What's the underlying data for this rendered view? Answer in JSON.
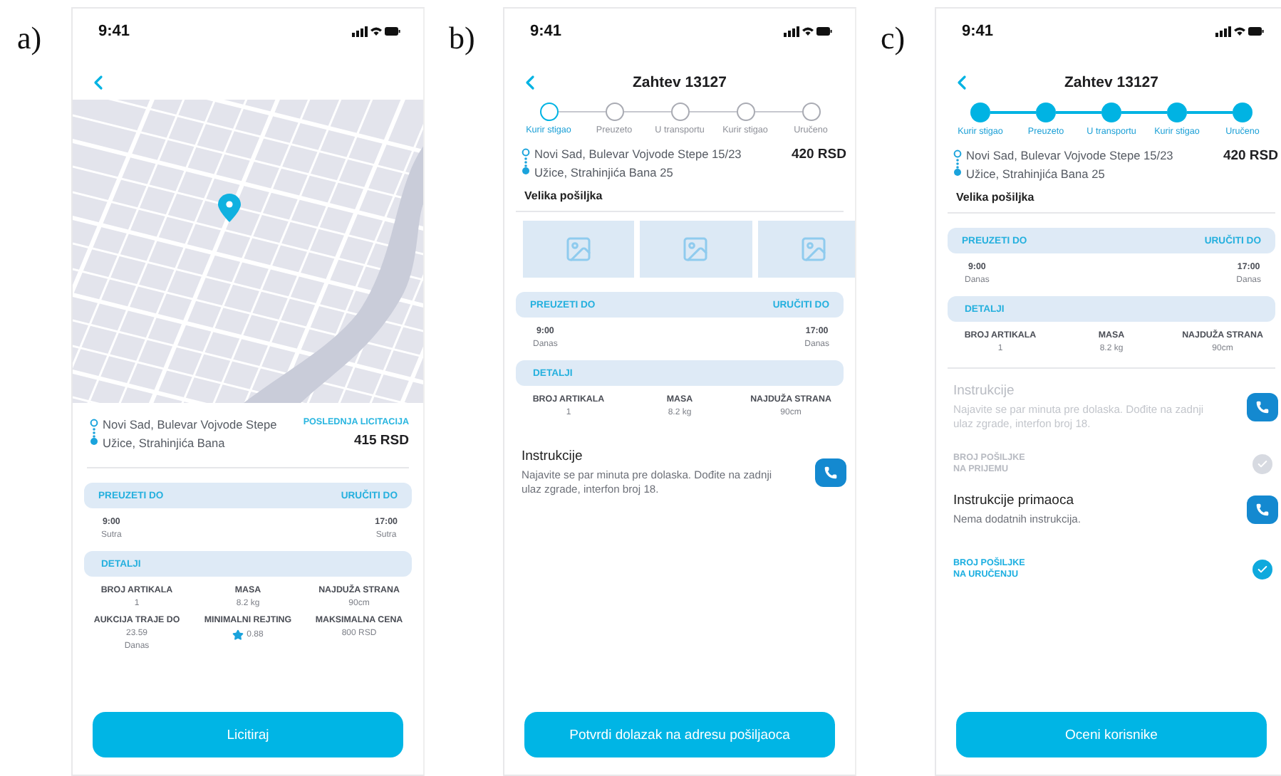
{
  "panels": [
    {
      "label": "a)",
      "status_time": "9:41",
      "sections": [
        {
          "kind": "header"
        },
        {
          "kind": "map"
        },
        {
          "kind": "route",
          "from": "Novi Sad, Bulevar Vojvode Stepe",
          "to": "Užice, Strahinjića Bana",
          "price_label": "POSLEDNJA LICITACIJA",
          "price": "415 RSD"
        },
        {
          "kind": "schedule",
          "pickup_label": "PREUZETI DO",
          "deliver_label": "URUČITI DO",
          "pickup_time": "9:00",
          "pickup_day": "Sutra",
          "deliver_time": "17:00",
          "deliver_day": "Sutra"
        },
        {
          "kind": "details",
          "title": "DETALJI",
          "items": [
            {
              "kind": "text",
              "label": "BROJ ARTIKALA",
              "value": "1"
            },
            {
              "kind": "text",
              "label": "MASA",
              "value": "8.2 kg"
            },
            {
              "kind": "text",
              "label": "NAJDUŽA STRANA",
              "value": "90cm"
            },
            {
              "kind": "text",
              "label": "AUKCIJA TRAJE DO",
              "value": "23.59",
              "sub": "Danas"
            },
            {
              "kind": "rating",
              "label": "MINIMALNI REJTING",
              "value": "0.88"
            },
            {
              "kind": "text",
              "label": "MAKSIMALNA CENA",
              "value": "800 RSD"
            }
          ]
        }
      ],
      "button": "Licitiraj"
    },
    {
      "label": "b)",
      "status_time": "9:41",
      "sections": [
        {
          "kind": "header",
          "title": "Zahtev 13127"
        },
        {
          "kind": "stepper",
          "steps": [
            {
              "label": "Kurir stigao",
              "done": false,
              "selected": true
            },
            {
              "label": "Preuzeto",
              "done": false,
              "selected": false
            },
            {
              "label": "U transportu",
              "done": false,
              "selected": false
            },
            {
              "label": "Kurir stigao",
              "done": false,
              "selected": false
            },
            {
              "label": "Uručeno",
              "done": false,
              "selected": false
            }
          ]
        },
        {
          "kind": "route",
          "from": "Novi Sad, Bulevar Vojvode Stepe 15/23",
          "to": "Užice, Strahinjića Bana 25",
          "price": "420 RSD"
        },
        {
          "kind": "package",
          "text": "Velika pošiljka"
        },
        {
          "kind": "photos",
          "items": [
            {
              "kind": "image"
            },
            {
              "kind": "image"
            },
            {
              "kind": "image"
            }
          ]
        },
        {
          "kind": "schedule",
          "pickup_label": "PREUZETI DO",
          "deliver_label": "URUČITI DO",
          "pickup_time": "9:00",
          "pickup_day": "Danas",
          "deliver_time": "17:00",
          "deliver_day": "Danas"
        },
        {
          "kind": "details",
          "title": "DETALJI",
          "items": [
            {
              "kind": "text",
              "label": "BROJ ARTIKALA",
              "value": "1"
            },
            {
              "kind": "text",
              "label": "MASA",
              "value": "8.2 kg"
            },
            {
              "kind": "text",
              "label": "NAJDUŽA STRANA",
              "value": "90cm"
            }
          ]
        },
        {
          "kind": "instruction",
          "title": "Instrukcije",
          "text": "Najavite se par minuta pre dolaska. Dođite na zadnji ulaz zgrade, interfon broj 18.",
          "disabled": false
        }
      ],
      "button": "Potvrdi dolazak na adresu pošiljaoca"
    },
    {
      "label": "c)",
      "status_time": "9:41",
      "sections": [
        {
          "kind": "header",
          "title": "Zahtev 13127"
        },
        {
          "kind": "stepper",
          "steps": [
            {
              "label": "Kurir stigao",
              "done": true,
              "selected": false
            },
            {
              "label": "Preuzeto",
              "done": true,
              "selected": false
            },
            {
              "label": "U transportu",
              "done": true,
              "selected": false
            },
            {
              "label": "Kurir stigao",
              "done": true,
              "selected": false
            },
            {
              "label": "Uručeno",
              "done": true,
              "selected": false
            }
          ]
        },
        {
          "kind": "route",
          "from": "Novi Sad, Bulevar Vojvode Stepe 15/23",
          "to": "Užice, Strahinjića Bana 25",
          "price": "420 RSD"
        },
        {
          "kind": "package",
          "text": "Velika pošiljka"
        },
        {
          "kind": "schedule",
          "pickup_label": "PREUZETI DO",
          "deliver_label": "URUČITI DO",
          "pickup_time": "9:00",
          "pickup_day": "Danas",
          "deliver_time": "17:00",
          "deliver_day": "Danas"
        },
        {
          "kind": "details",
          "title": "DETALJI",
          "items": [
            {
              "kind": "text",
              "label": "BROJ ARTIKALA",
              "value": "1"
            },
            {
              "kind": "text",
              "label": "MASA",
              "value": "8.2 kg"
            },
            {
              "kind": "text",
              "label": "NAJDUŽA STRANA",
              "value": "90cm"
            }
          ]
        },
        {
          "kind": "instruction",
          "title": "Instrukcije",
          "text": "Najavite se par minuta pre dolaska. Dođite na zadnji ulaz zgrade, interfon broj 18.",
          "disabled": true
        },
        {
          "kind": "confirmation",
          "text": "BROJ POŠILJKE\nNA PRIJEMU",
          "checked": true,
          "disabled": true
        },
        {
          "kind": "instruction",
          "title": "Instrukcije primaoca",
          "text": "Nema dodatnih instrukcija.",
          "disabled": false
        },
        {
          "kind": "confirmation",
          "text": "BROJ POŠILJKE\nNA URUČENJU",
          "checked": true,
          "disabled": false
        }
      ],
      "button": "Oceni korisnike"
    }
  ]
}
